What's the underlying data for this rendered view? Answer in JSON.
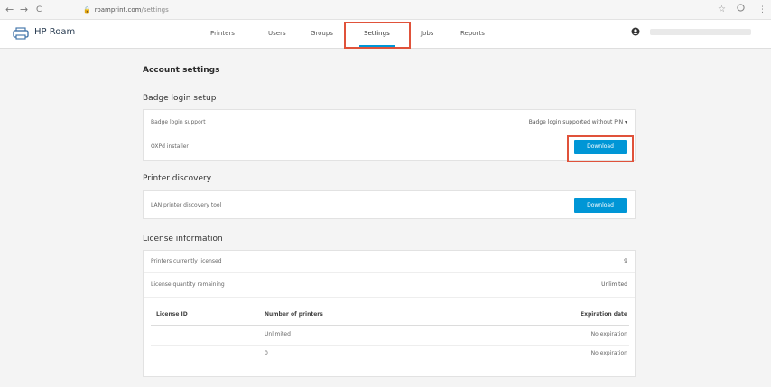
{
  "browser": {
    "back": "←",
    "forward": "→",
    "reload": "C",
    "lock": "🔒",
    "host": "roamprint.com",
    "path": "/settings",
    "star": "☆",
    "menu": "⋮"
  },
  "header": {
    "brand": "HP Roam",
    "nav": [
      "Printers",
      "Users",
      "Groups",
      "Settings",
      "Jobs",
      "Reports"
    ],
    "active_tab": "Settings"
  },
  "page": {
    "title": "Account settings",
    "badge": {
      "title": "Badge login setup",
      "support_label": "Badge login support",
      "support_value": "Badge login supported without PIN ▾",
      "installer_label": "OXPd installer",
      "download_label": "Download"
    },
    "discovery": {
      "title": "Printer discovery",
      "tool_label": "LAN printer discovery tool",
      "download_label": "Download"
    },
    "license": {
      "title": "License information",
      "printers_label": "Printers currently licensed",
      "printers_value": "9",
      "quantity_label": "License quantity remaining",
      "quantity_value": "Unlimited",
      "table": {
        "headers": [
          "License ID",
          "Number of printers",
          "Expiration date"
        ],
        "rows": [
          [
            "",
            "Unlimited",
            "No expiration"
          ],
          [
            "",
            "0",
            "No expiration"
          ]
        ]
      }
    }
  },
  "colors": {
    "accent": "#0096d6",
    "highlight": "#e0523a"
  }
}
